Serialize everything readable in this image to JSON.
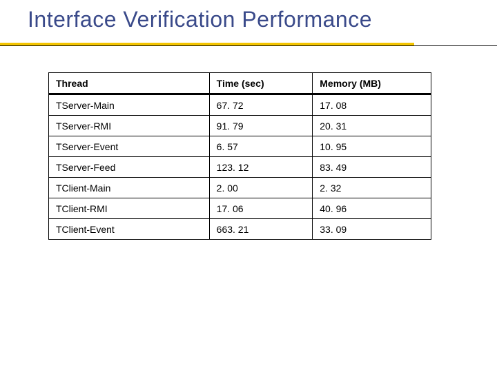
{
  "title": "Interface Verification Performance",
  "table": {
    "headers": [
      "Thread",
      "Time (sec)",
      "Memory (MB)"
    ],
    "rows": [
      [
        "TServer-Main",
        "67. 72",
        "17. 08"
      ],
      [
        "TServer-RMI",
        "91. 79",
        "20. 31"
      ],
      [
        "TServer-Event",
        "6. 57",
        "10. 95"
      ],
      [
        "TServer-Feed",
        "123. 12",
        "83. 49"
      ],
      [
        "TClient-Main",
        "2. 00",
        "2. 32"
      ],
      [
        "TClient-RMI",
        "17. 06",
        "40. 96"
      ],
      [
        "TClient-Event",
        "663. 21",
        "33. 09"
      ]
    ]
  },
  "chart_data": {
    "type": "table",
    "title": "Interface Verification Performance",
    "columns": [
      "Thread",
      "Time (sec)",
      "Memory (MB)"
    ],
    "rows": [
      {
        "Thread": "TServer-Main",
        "Time (sec)": 67.72,
        "Memory (MB)": 17.08
      },
      {
        "Thread": "TServer-RMI",
        "Time (sec)": 91.79,
        "Memory (MB)": 20.31
      },
      {
        "Thread": "TServer-Event",
        "Time (sec)": 6.57,
        "Memory (MB)": 10.95
      },
      {
        "Thread": "TServer-Feed",
        "Time (sec)": 123.12,
        "Memory (MB)": 83.49
      },
      {
        "Thread": "TClient-Main",
        "Time (sec)": 2.0,
        "Memory (MB)": 2.32
      },
      {
        "Thread": "TClient-RMI",
        "Time (sec)": 17.06,
        "Memory (MB)": 40.96
      },
      {
        "Thread": "TClient-Event",
        "Time (sec)": 663.21,
        "Memory (MB)": 33.09
      }
    ]
  }
}
